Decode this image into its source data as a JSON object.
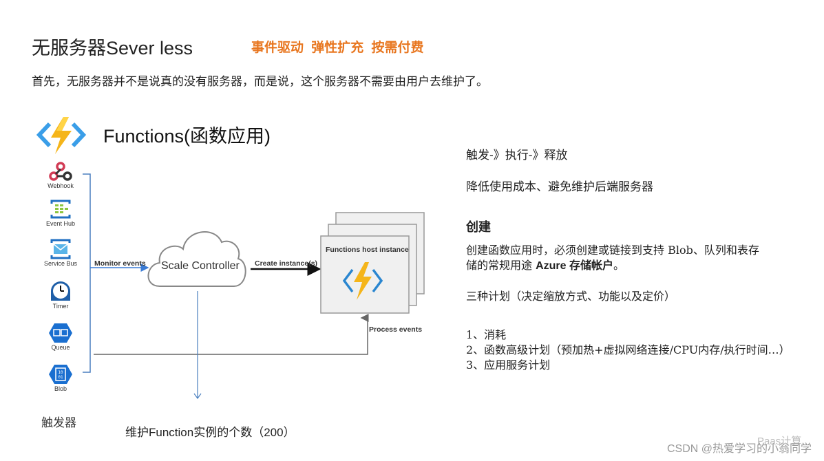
{
  "header": {
    "title": "无服务器Sever less",
    "keywords": "事件驱动  弹性扩充  按需付费",
    "intro": "首先，无服务器并不是说真的没有服务器，而是说，这个服务器不需要由用户去维护了。",
    "accent_color": "#e8761f"
  },
  "functions": {
    "title": "Functions(函数应用)",
    "logo_icon": "azure-functions-icon"
  },
  "triggers": {
    "caption": "触发器",
    "items": [
      {
        "label": "Webhook",
        "icon": "webhook-icon"
      },
      {
        "label": "Event Hub",
        "icon": "event-hub-icon"
      },
      {
        "label": "Service Bus",
        "icon": "service-bus-icon"
      },
      {
        "label": "Timer",
        "icon": "timer-icon"
      },
      {
        "label": "Queue",
        "icon": "queue-icon"
      },
      {
        "label": "Blob",
        "icon": "blob-icon"
      }
    ]
  },
  "diagram": {
    "monitor_events": "Monitor events",
    "scale_controller": "Scale Controller",
    "create_instances": "Create instance(s)",
    "host_instance": "Functions host instance",
    "process_events": "Process events",
    "maintain_note": "维护Function实例的个数（200）"
  },
  "notes": {
    "flow": "触发-》执行-》释放",
    "benefit": "降低使用成本、避免维护后端服务器",
    "create_heading": "创建",
    "create_line1": "创建函数应用时，必须创建或链接到支持 Blob、队列和表存",
    "create_line2_prefix": "储的常规用途 ",
    "create_line2_bold": "Azure 存储帐户",
    "create_line2_suffix": "。",
    "plans_heading": "三种计划（决定缩放方式、功能以及定价）",
    "plans": [
      "1、消耗",
      "2、函数高级计划（预加热+虚拟网络连接/CPU内存/执行时间…）",
      "3、应用服务计划"
    ]
  },
  "watermark": "CSDN @热爱学习的小翁同学",
  "watermark_ghost": "Paas计算"
}
